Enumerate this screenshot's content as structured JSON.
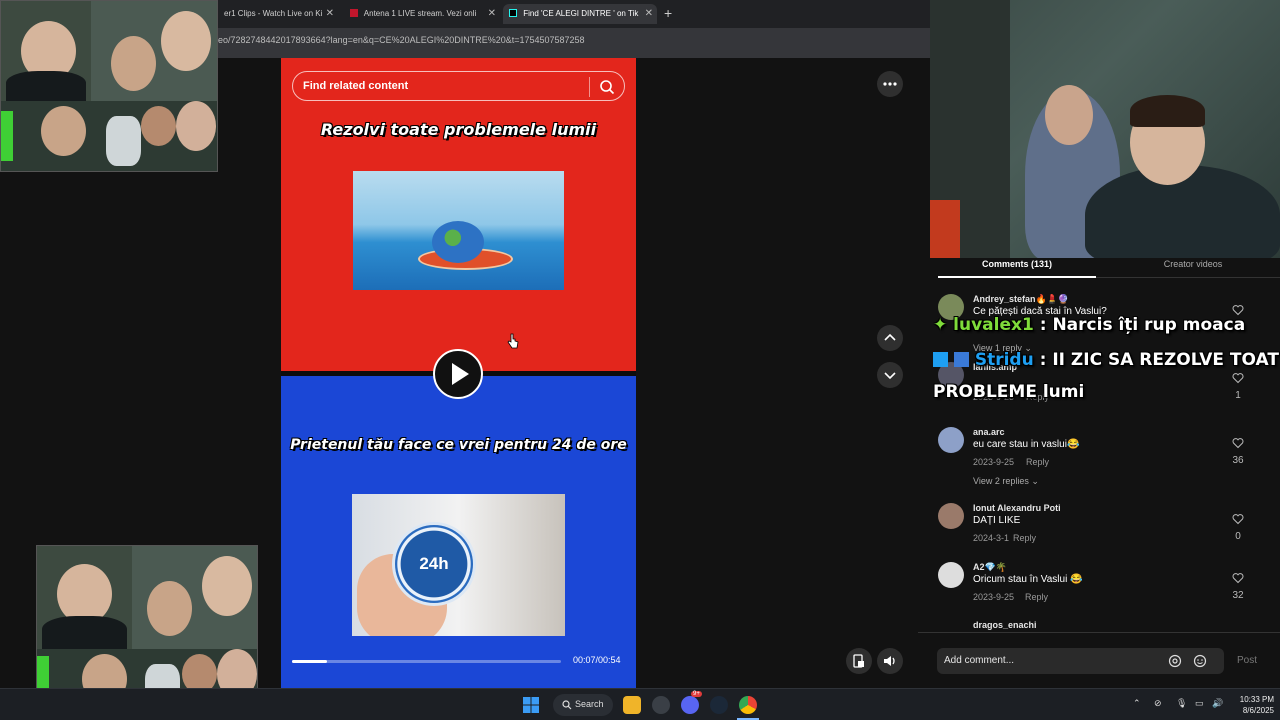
{
  "browser": {
    "tabs": [
      {
        "label": "er1 Clips - Watch Live on Ki"
      },
      {
        "label": "Antena 1 LIVE stream. Vezi onli"
      },
      {
        "label": "Find 'CE ALEGI DINTRE ' on Tik"
      }
    ],
    "url": "eo/7282748442017893664?lang=en&q=CE%20ALEGI%20DINTRE%20&t=1754507587258"
  },
  "video": {
    "search_placeholder": "Find related content",
    "option1_text": "Rezolvi toate problemele lumii",
    "option2_text": "Prietenul tău face ce vrei pentru 24 de ore",
    "clock_label": "24h",
    "time": "00:07/00:54",
    "progress": 0.13,
    "colors": {
      "top": "#e3261c",
      "bottom": "#1b47d6"
    }
  },
  "comments": {
    "tab_comments": "Comments (131)",
    "tab_creator": "Creator videos",
    "items": [
      {
        "name": "Andrey_stefan🔥💄🔮",
        "text": "Ce pățești dacă stai în Vaslui?",
        "date": "",
        "reply": "",
        "likes": "1",
        "view": "View 1 reply ⌄"
      },
      {
        "name": "laniis.amp",
        "text": "",
        "date": "2023-9-25",
        "reply": "Reply",
        "likes": "1",
        "view": ""
      },
      {
        "name": "ana.arc",
        "text": "eu care stau in vaslui😂",
        "date": "2023-9-25",
        "reply": "Reply",
        "likes": "36",
        "view": "View 2 replies ⌄"
      },
      {
        "name": "Ionut Alexandru Poti",
        "text": "DAȚI LIKE",
        "date": "2024-3-1",
        "reply": "Reply",
        "likes": "0",
        "view": ""
      },
      {
        "name": "A2💎🌴",
        "text": "Oricum stau în Vaslui 😂",
        "date": "2023-9-25",
        "reply": "Reply",
        "likes": "32",
        "view": ""
      },
      {
        "name": "dragos_enachi",
        "text": "",
        "date": "",
        "reply": "",
        "likes": "",
        "view": ""
      }
    ],
    "add_placeholder": "Add comment...",
    "post_label": "Post"
  },
  "chat_overlay": [
    {
      "user": "luvalex1",
      "message": ": Narcis îți rup moaca"
    },
    {
      "user": "Stridu",
      "message": ": II ZIC SA REZOLVE TOAT",
      "message2": "PROBLEME lumi"
    }
  ],
  "taskbar": {
    "search_label": "Search",
    "time": "10:33 PM",
    "date": "8/6/2025",
    "discord_badge": "9+"
  }
}
